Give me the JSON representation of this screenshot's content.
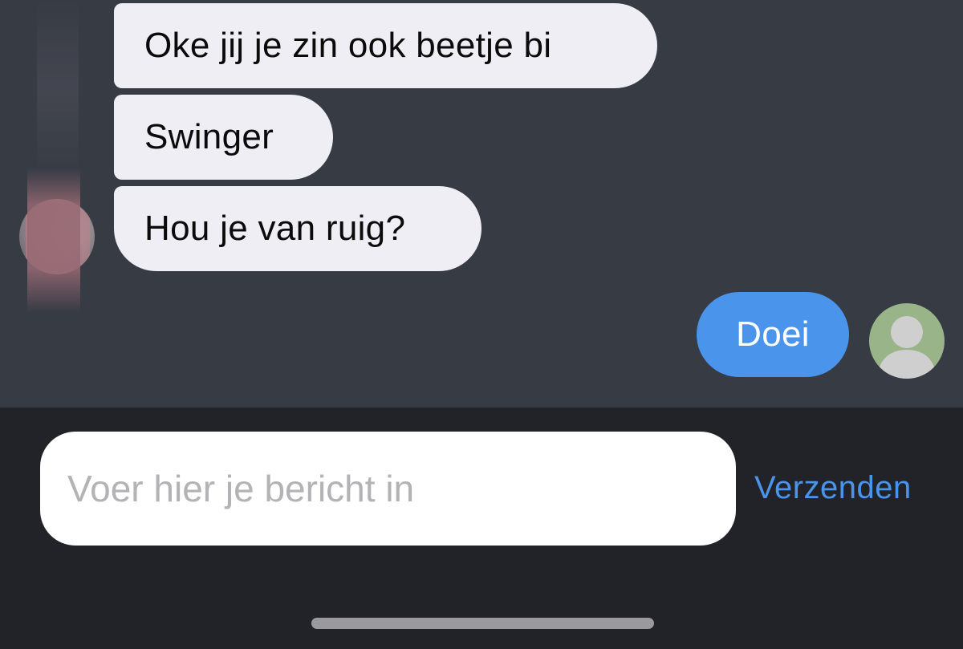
{
  "messages": [
    {
      "sender": "contact",
      "text": "Oke jij je zin ook beetje bi"
    },
    {
      "sender": "contact",
      "text": "Swinger"
    },
    {
      "sender": "contact",
      "text": "Hou je van ruig?"
    },
    {
      "sender": "user",
      "text": "Doei"
    }
  ],
  "composer": {
    "placeholder": "Voer hier je bericht in",
    "value": "",
    "send_label": "Verzenden"
  },
  "colors": {
    "chat_background": "#373b44",
    "incoming_bubble": "#efeef4",
    "outgoing_bubble": "#4a94ec",
    "composer_background": "#222328",
    "accent": "#4a94ec"
  },
  "icons": {
    "contact_avatar": "avatar-photo-icon",
    "user_avatar": "default-person-icon"
  }
}
